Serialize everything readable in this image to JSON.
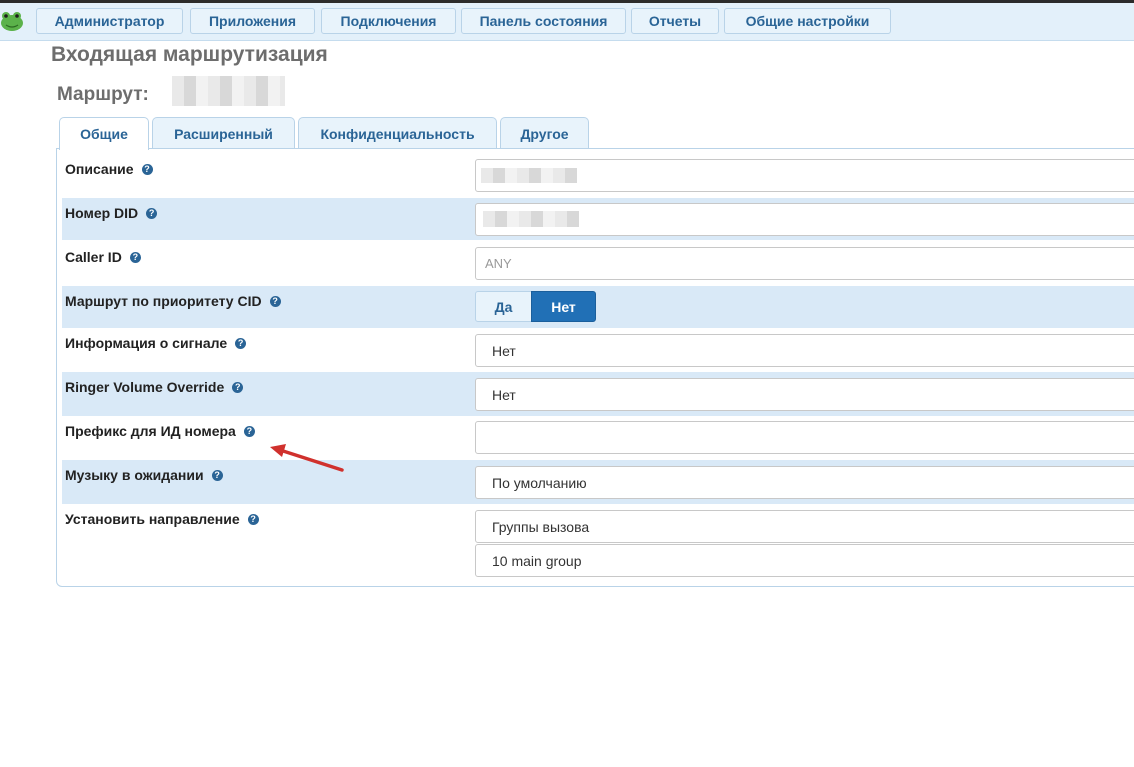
{
  "nav": {
    "items": [
      {
        "label": "Администратор"
      },
      {
        "label": "Приложения"
      },
      {
        "label": "Подключения"
      },
      {
        "label": "Панель состояния"
      },
      {
        "label": "Отчеты"
      },
      {
        "label": "Общие настройки"
      }
    ]
  },
  "page": {
    "title": "Входящая маршрутизация",
    "route_label": "Маршрут:"
  },
  "tabs": [
    {
      "label": "Общие",
      "active": true
    },
    {
      "label": "Расширенный",
      "active": false
    },
    {
      "label": "Конфиденциальность",
      "active": false
    },
    {
      "label": "Другое",
      "active": false
    }
  ],
  "form": {
    "description": {
      "label": "Описание",
      "value": ""
    },
    "did": {
      "label": "Номер DID",
      "value": ""
    },
    "caller_id": {
      "label": "Caller ID",
      "placeholder": "ANY"
    },
    "cid_priority": {
      "label": "Маршрут по приоритету CID",
      "options": [
        "Да",
        "Нет"
      ],
      "selected": "Нет"
    },
    "alert_info": {
      "label": "Информация о сигнале",
      "value": "Нет"
    },
    "ringer_volume": {
      "label": "Ringer Volume Override",
      "value": "Нет"
    },
    "cid_prefix": {
      "label": "Префикс для ИД номера",
      "value": ""
    },
    "moh": {
      "label": "Музыку в ожидании",
      "value": "По умолчанию"
    },
    "destination": {
      "label": "Установить направление",
      "type": "Группы вызова",
      "target": "10 main group"
    }
  },
  "colors": {
    "accent": "#2170b6",
    "link": "#2a6496",
    "row_highlight": "#d9e9f7",
    "annotation_arrow": "#d0312d"
  }
}
